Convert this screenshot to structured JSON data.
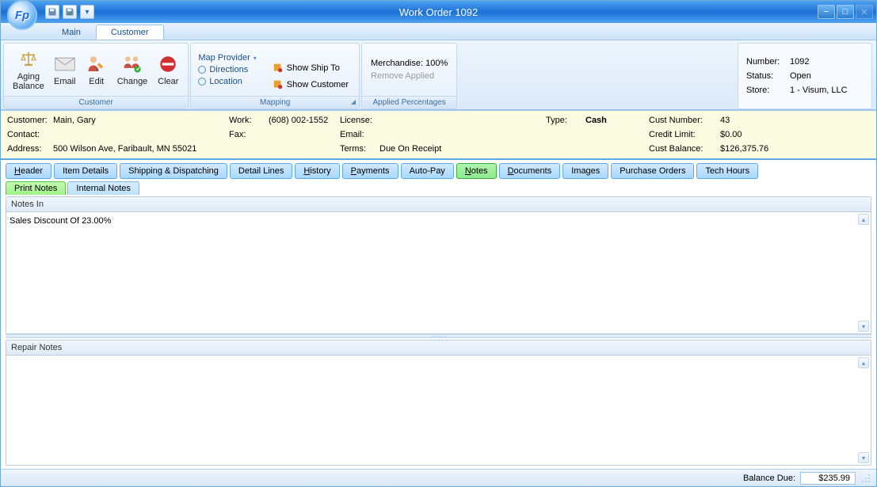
{
  "window": {
    "title": "Work Order 1092",
    "app_logo": "Fp"
  },
  "main_tabs": [
    "Main",
    "Customer"
  ],
  "main_tab_active": 1,
  "ribbon": {
    "customer_group": {
      "label": "Customer",
      "buttons": [
        {
          "name": "aging-balance",
          "label": "Aging\nBalance",
          "icon": "scale"
        },
        {
          "name": "email",
          "label": "Email",
          "icon": "envelope"
        },
        {
          "name": "edit",
          "label": "Edit",
          "icon": "person-edit"
        },
        {
          "name": "change",
          "label": "Change",
          "icon": "person-swap"
        },
        {
          "name": "clear",
          "label": "Clear",
          "icon": "no-entry"
        }
      ]
    },
    "mapping_group": {
      "label": "Mapping",
      "provider_label": "Map Provider",
      "radios": [
        "Directions",
        "Location"
      ],
      "buttons": [
        "Show Ship To",
        "Show Customer"
      ]
    },
    "applied_group": {
      "label": "Applied Percentages",
      "merchandise_label": "Merchandise:",
      "merchandise_value": "100%",
      "remove_label": "Remove Applied"
    }
  },
  "info": {
    "number_label": "Number:",
    "number": "1092",
    "status_label": "Status:",
    "status": "Open",
    "store_label": "Store:",
    "store": "1 - Visum, LLC"
  },
  "customer": {
    "customer_label": "Customer:",
    "customer": "Main, Gary",
    "contact_label": "Contact:",
    "contact": "",
    "address_label": "Address:",
    "address": "500 Wilson Ave, Faribault, MN 55021",
    "work_label": "Work:",
    "work": "(608) 002-1552",
    "fax_label": "Fax:",
    "fax": "",
    "license_label": "License:",
    "license": "",
    "email_label": "Email:",
    "email": "",
    "terms_label": "Terms:",
    "terms": "Due On Receipt",
    "type_label": "Type:",
    "type": "Cash",
    "cust_number_label": "Cust Number:",
    "cust_number": "43",
    "credit_limit_label": "Credit Limit:",
    "credit_limit": "$0.00",
    "cust_balance_label": "Cust Balance:",
    "cust_balance": "$126,375.76"
  },
  "subtabs": [
    {
      "label": "Header",
      "u": "H"
    },
    {
      "label": "Item Details",
      "u": ""
    },
    {
      "label": "Shipping & Dispatching",
      "u": ""
    },
    {
      "label": "Detail Lines",
      "u": ""
    },
    {
      "label": "History",
      "u": "H"
    },
    {
      "label": "Payments",
      "u": "P"
    },
    {
      "label": "Auto-Pay",
      "u": ""
    },
    {
      "label": "Notes",
      "u": "N"
    },
    {
      "label": "Documents",
      "u": "D"
    },
    {
      "label": "Images",
      "u": ""
    },
    {
      "label": "Purchase Orders",
      "u": ""
    },
    {
      "label": "Tech Hours",
      "u": ""
    }
  ],
  "subtab_active": 7,
  "notes_tabs": [
    "Print Notes",
    "Internal Notes"
  ],
  "notes_tab_active": 0,
  "sections": {
    "notes_in_label": "Notes In",
    "notes_in_value": "Sales Discount Of 23.00%",
    "repair_notes_label": "Repair Notes",
    "repair_notes_value": ""
  },
  "status": {
    "balance_due_label": "Balance Due:",
    "balance_due": "$235.99"
  }
}
